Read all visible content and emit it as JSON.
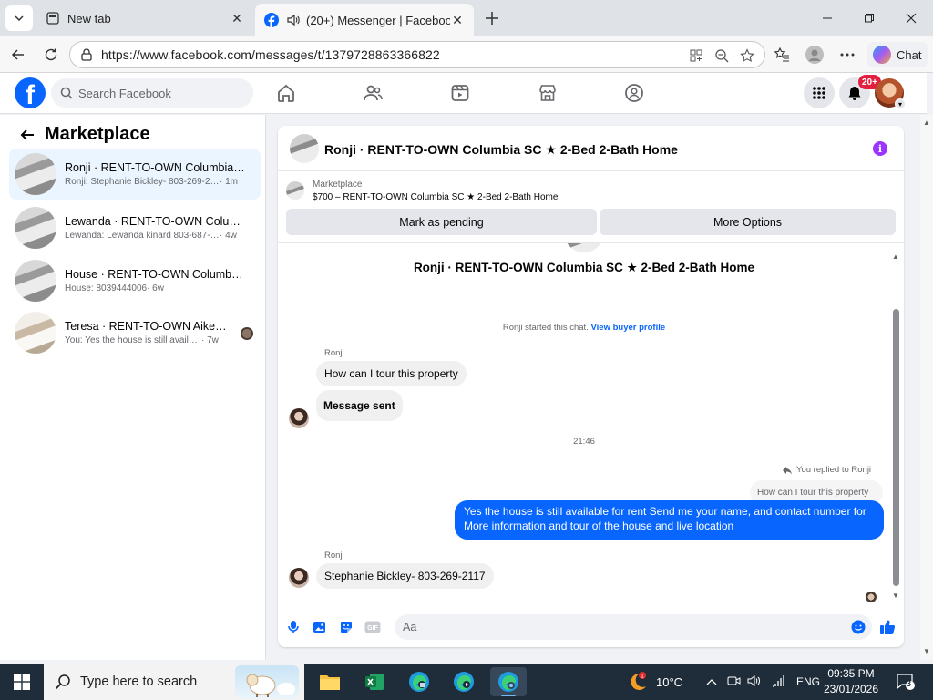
{
  "browser": {
    "tabs": [
      {
        "title": "New tab",
        "close": "✕"
      },
      {
        "title": "(20+) Messenger | Facebook",
        "close": "✕"
      }
    ],
    "url": "https://www.facebook.com/messages/t/1379728863366822",
    "chat_label": "Chat"
  },
  "header": {
    "logo_letter": "f",
    "search_placeholder": "Search Facebook",
    "notification_badge": "20+",
    "nav_icons": [
      "home-icon",
      "friends-icon",
      "video-icon",
      "marketplace-icon",
      "groups-icon"
    ]
  },
  "sidebar": {
    "title": "Marketplace",
    "conversations": [
      {
        "name": "Ronji · RENT-TO-OWN Columbia S...",
        "preview": "Ronji: Stephanie Bickley- 803-269-21...",
        "time": "· 1m"
      },
      {
        "name": "Lewanda · RENT-TO-OWN Columb...",
        "preview": "Lewanda: Lewanda kinard 803-687-1...",
        "time": "· 4w"
      },
      {
        "name": "House · RENT-TO-OWN Columbia ...",
        "preview": "House: 8039444006",
        "time": "· 6w"
      },
      {
        "name": "Teresa · RENT-TO-OWN Aiken S...",
        "preview": "You: Yes the house is still available ...",
        "time": "· 7w"
      }
    ]
  },
  "chat": {
    "title": "Ronji · RENT-TO-OWN Columbia SC ★ 2-Bed 2-Bath Home",
    "listing_category": "Marketplace",
    "listing_desc": "$700 – RENT-TO-OWN Columbia SC ★ 2-Bed 2-Bath Home",
    "mark_pending": "Mark as pending",
    "more_options": "More Options",
    "thread_title": "Ronji · RENT-TO-OWN Columbia SC ★ 2-Bed 2-Bath Home",
    "started_text": "Ronji started this chat.",
    "buyer_profile_link": "View buyer profile",
    "sender_name_1": "Ronji",
    "msg_1": "How can I tour this property",
    "msg_2": "Message sent",
    "timestamp": "21:46",
    "replied_label": "You replied to Ronji",
    "quoted_msg": "How can I tour this property",
    "msg_out": "Yes the house is still available for rent Send me your name, and contact number for More information and tour of the house and live location",
    "sender_name_2": "Ronji",
    "msg_3": "Stephanie Bickley- 803-269-2117",
    "input_placeholder": "Aa"
  },
  "taskbar": {
    "search_placeholder": "Type here to search",
    "weather": "10°C",
    "language": "ENG",
    "time": "09:35 PM",
    "date": "23/01/2026",
    "notification_count": "3"
  },
  "colors": {
    "fb_blue": "#0866ff",
    "active_convo": "#ebf5ff",
    "badge_red": "#e41e3f",
    "info_purple": "#9b36ff"
  }
}
